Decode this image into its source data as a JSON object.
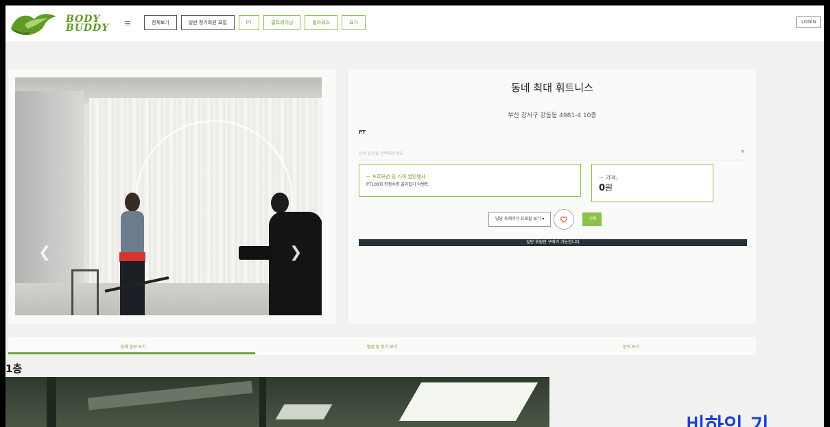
{
  "header": {
    "logo": {
      "line1": "BODY",
      "line2": "BUDDY",
      "brand_color": "#5e9a26"
    },
    "nav": [
      {
        "label": "전체보기",
        "style": "dark"
      },
      {
        "label": "일반 정기회원 모집",
        "style": "dark"
      },
      {
        "label": "PT",
        "style": "green"
      },
      {
        "label": "홈트레이닝",
        "style": "green"
      },
      {
        "label": "필라테스",
        "style": "green"
      },
      {
        "label": "요가",
        "style": "green"
      }
    ],
    "login_label": "LOGIN"
  },
  "gallery": {
    "prev_icon": "chevron-left-icon",
    "next_icon": "chevron-right-icon"
  },
  "product": {
    "title": "동네 최대 휘트니스",
    "address": "부산 강서구 강동동 4981-4 10층",
    "category": "PT",
    "option_placeholder": "상세 옵션을 선택해주세요",
    "promo": {
      "heading": "ㅡ 프로모션 및 가격 할인행사",
      "text": "PT100회 한정수량 골라잡기 이벤트"
    },
    "price": {
      "heading": "ㅡ 가격:",
      "value": "0",
      "unit": "원"
    },
    "trainer_button": "담당 트레이너 프로필 보기 ▾",
    "buy_button": "구매",
    "notice": "일반 회원만 구매가 가능합니다",
    "accent_color": "#8bc34a"
  },
  "tabs": [
    {
      "label": "상세 정보 보기",
      "active": true
    },
    {
      "label": "별점 및 후기 보기",
      "active": false
    },
    {
      "label": "문의 보기",
      "active": false
    }
  ],
  "detail": {
    "floor_title": "1층",
    "overlay_caption": "비하인 기"
  }
}
